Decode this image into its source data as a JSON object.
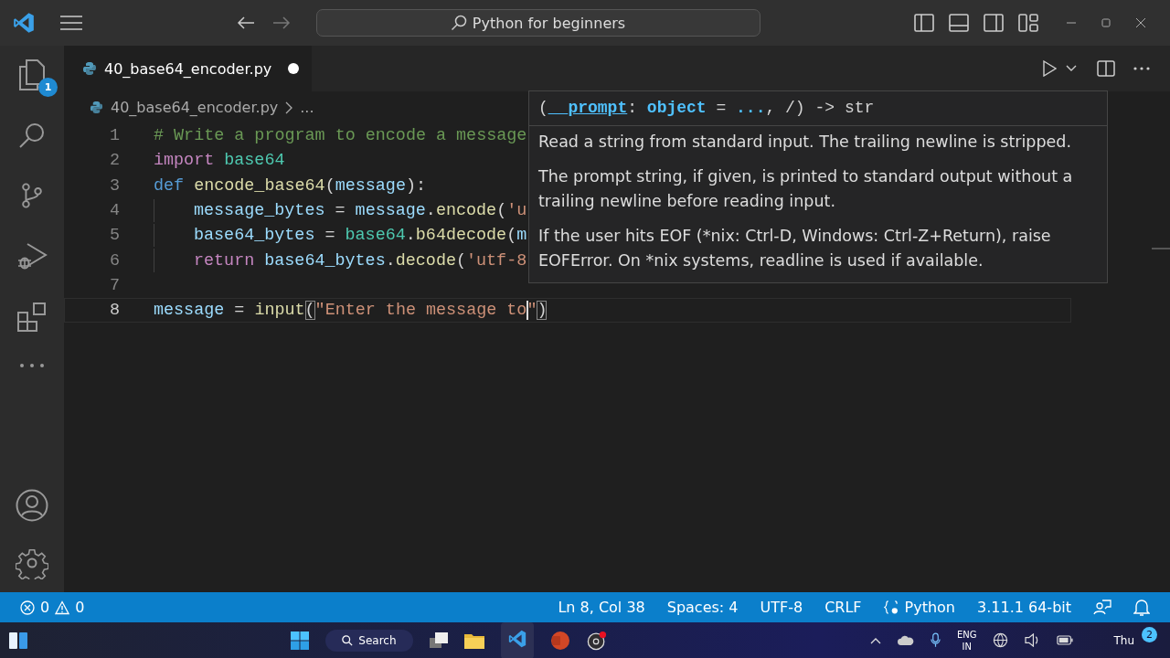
{
  "title_bar": {
    "search": "Python for beginners"
  },
  "activity_bar": {
    "explorer_badge": "1"
  },
  "tabs": [
    {
      "label": "40_base64_encoder.py",
      "selected": true,
      "modified": true
    }
  ],
  "breadcrumb": [
    "40_base64_encoder.py",
    "..."
  ],
  "editor": {
    "lines": [
      {
        "number": "1",
        "indented": false,
        "current": false,
        "tokens": [
          {
            "t": "# Write a program to encode a message",
            "kind": "comment"
          }
        ]
      },
      {
        "number": "2",
        "indented": false,
        "current": false,
        "tokens": [
          {
            "t": "import",
            "kind": "keyword"
          },
          {
            "t": " base64",
            "kind": "module"
          }
        ]
      },
      {
        "number": "3",
        "indented": false,
        "current": false,
        "tokens": [
          {
            "t": "def",
            "kind": "storage"
          },
          {
            "t": " encode_base64",
            "kind": "func"
          },
          {
            "t": "(",
            "kind": "plain"
          },
          {
            "t": "message",
            "kind": "var"
          },
          {
            "t": "):",
            "kind": "plain"
          }
        ]
      },
      {
        "number": "4",
        "indented": true,
        "current": false,
        "tokens": [
          {
            "t": "message_bytes",
            "kind": "var"
          },
          {
            "t": " = ",
            "kind": "plain"
          },
          {
            "t": "message",
            "kind": "var"
          },
          {
            "t": ".",
            "kind": "plain"
          },
          {
            "t": "encode",
            "kind": "func"
          },
          {
            "t": "(",
            "kind": "plain"
          },
          {
            "t": "'u",
            "kind": "string"
          }
        ]
      },
      {
        "number": "5",
        "indented": true,
        "current": false,
        "tokens": [
          {
            "t": "base64_bytes",
            "kind": "var"
          },
          {
            "t": " = ",
            "kind": "plain"
          },
          {
            "t": "base64",
            "kind": "module"
          },
          {
            "t": ".",
            "kind": "plain"
          },
          {
            "t": "b64decode",
            "kind": "func"
          },
          {
            "t": "(",
            "kind": "plain"
          },
          {
            "t": "m",
            "kind": "var"
          }
        ]
      },
      {
        "number": "6",
        "indented": true,
        "current": false,
        "tokens": [
          {
            "t": "return",
            "kind": "keyword"
          },
          {
            "t": " base64_bytes",
            "kind": "var"
          },
          {
            "t": ".",
            "kind": "plain"
          },
          {
            "t": "decode",
            "kind": "func"
          },
          {
            "t": "(",
            "kind": "plain"
          },
          {
            "t": "'utf-8",
            "kind": "string"
          }
        ]
      },
      {
        "number": "7",
        "indented": false,
        "current": false
      },
      {
        "number": "8",
        "indented": false,
        "current": true,
        "tokens": [
          {
            "t": "message",
            "kind": "var"
          },
          {
            "t": " = ",
            "kind": "plain"
          },
          {
            "t": "input",
            "kind": "func"
          },
          {
            "t": "(",
            "kind": "bracket"
          },
          {
            "t": "\"Enter the message to",
            "kind": "string"
          },
          {
            "t": "\"",
            "kind": "string",
            "cursor": true
          },
          {
            "t": ")",
            "kind": "bracket"
          }
        ]
      }
    ]
  },
  "hover": {
    "signature": [
      {
        "t": "(",
        "kind": "plain"
      },
      {
        "t": "__prompt",
        "kind": "param"
      },
      {
        "t": ": ",
        "kind": "plain"
      },
      {
        "t": "object",
        "kind": "type"
      },
      {
        "t": " = ",
        "kind": "plain"
      },
      {
        "t": "...",
        "kind": "type"
      },
      {
        "t": ", /) -> str",
        "kind": "plain"
      }
    ],
    "paragraphs": [
      "Read a string from standard input. The trailing newline is stripped.",
      "The prompt string, if given, is printed to standard output without a trailing newline before reading input.",
      "If the user hits EOF (*nix: Ctrl-D, Windows: Ctrl-Z+Return), raise EOFError. On *nix systems, readline is used if available."
    ]
  },
  "status_bar": {
    "errors": "0",
    "warnings": "0",
    "items": [
      "Ln 8, Col 38",
      "Spaces: 4",
      "UTF-8",
      "CRLF"
    ],
    "language": "Python",
    "interpreter": "3.11.1 64-bit"
  },
  "taskbar": {
    "search": "Search",
    "language": [
      "ENG",
      "IN"
    ],
    "day": "Thu",
    "notification_count": "2"
  }
}
